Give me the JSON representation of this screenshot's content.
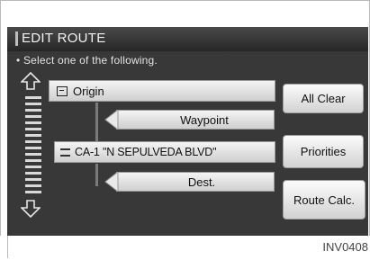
{
  "screen": {
    "title": "EDIT ROUTE",
    "prompt": "Select one of the following."
  },
  "route": {
    "origin_label": "Origin",
    "waypoint_label": "Waypoint",
    "road_label": "CA-1 \"N SEPULVEDA BLVD\"",
    "dest_label": "Dest."
  },
  "buttons": {
    "all_clear": "All Clear",
    "priorities": "Priorities",
    "route_calc": "Route Calc."
  },
  "icons": {
    "scroll_up": "up-arrow-outline-icon",
    "scroll_down": "down-arrow-outline-icon",
    "origin": "flag-icon",
    "road": "road-icon"
  },
  "figure_code": "INV0408",
  "colors": {
    "screen_bg": "#383838",
    "button_face": "#e6e6e6",
    "text_light": "#f2f2f2"
  }
}
